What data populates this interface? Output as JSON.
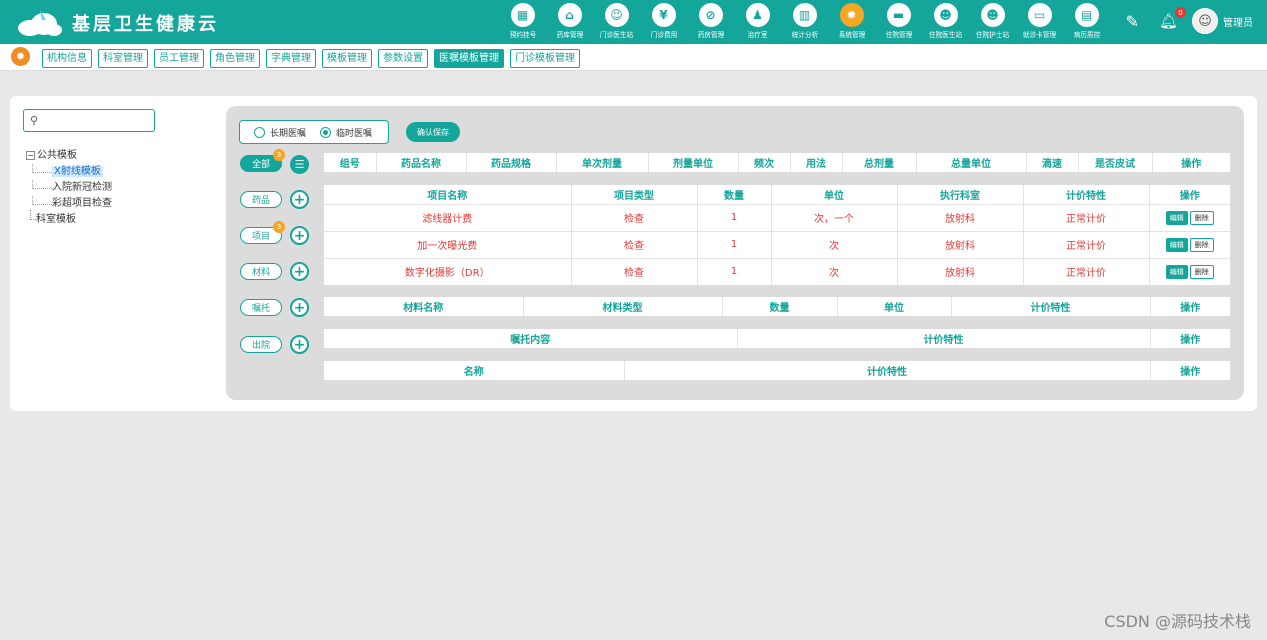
{
  "header": {
    "app_title": "基层卫生健康云",
    "nav": [
      {
        "label": "预约挂号",
        "icon": "calendar-icon",
        "glyph": "▦"
      },
      {
        "label": "药库管理",
        "icon": "warehouse-icon",
        "glyph": "⌂"
      },
      {
        "label": "门诊医生站",
        "icon": "doctor-icon",
        "glyph": "☺"
      },
      {
        "label": "门诊费用",
        "icon": "yen-icon",
        "glyph": "¥"
      },
      {
        "label": "药房管理",
        "icon": "pill-icon",
        "glyph": "⊘"
      },
      {
        "label": "治疗室",
        "icon": "therapy-icon",
        "glyph": "♟"
      },
      {
        "label": "统计分析",
        "icon": "chart-icon",
        "glyph": "▥"
      },
      {
        "label": "系统管理",
        "icon": "gear-icon",
        "glyph": "✹"
      },
      {
        "label": "住院管理",
        "icon": "bed-icon",
        "glyph": "▬"
      },
      {
        "label": "住院医生站",
        "icon": "inpatient-doctor-icon",
        "glyph": "☻"
      },
      {
        "label": "住院护士站",
        "icon": "nurse-icon",
        "glyph": "☻"
      },
      {
        "label": "就诊卡管理",
        "icon": "card-icon",
        "glyph": "▭"
      },
      {
        "label": "病历质控",
        "icon": "record-icon",
        "glyph": "▤"
      }
    ],
    "active_nav": 7,
    "notification_count": "0",
    "username": "管理员"
  },
  "tabs": [
    "机构信息",
    "科室管理",
    "员工管理",
    "角色管理",
    "字典管理",
    "模板管理",
    "参数设置",
    "医嘱模板管理",
    "门诊模板管理"
  ],
  "active_tab": 7,
  "search": {
    "placeholder": ""
  },
  "tree": {
    "root": "公共模板",
    "toggle": "−",
    "children": [
      "X射线模板",
      "入院新冠检测",
      "彩超项目检查"
    ],
    "selected": 0,
    "sibling": "科室模板"
  },
  "order_type": {
    "long_term": "长期医嘱",
    "temporary": "临时医嘱",
    "checked": "temporary"
  },
  "save_label": "确认保存",
  "categories": [
    {
      "label": "全部",
      "badge": "3"
    },
    {
      "label": "药品",
      "badge": ""
    },
    {
      "label": "项目",
      "badge": "3"
    },
    {
      "label": "材料",
      "badge": ""
    },
    {
      "label": "嘱托",
      "badge": ""
    },
    {
      "label": "出院",
      "badge": ""
    }
  ],
  "drug_table": {
    "headers": [
      "组号",
      "药品名称",
      "药品规格",
      "单次剂量",
      "剂量单位",
      "频次",
      "用法",
      "总剂量",
      "总量单位",
      "滴速",
      "是否皮试",
      "操作"
    ]
  },
  "item_table": {
    "headers": [
      "项目名称",
      "项目类型",
      "数量",
      "单位",
      "执行科室",
      "计价特性",
      "操作"
    ],
    "rows": [
      {
        "name": "滤线器计费",
        "type": "检查",
        "qty": "1",
        "unit": "次，一个",
        "dept": "放射科",
        "pricing": "正常计价"
      },
      {
        "name": "加一次曝光费",
        "type": "检查",
        "qty": "1",
        "unit": "次",
        "dept": "放射科",
        "pricing": "正常计价"
      },
      {
        "name": "数字化摄影（DR）",
        "type": "检查",
        "qty": "1",
        "unit": "次",
        "dept": "放射科",
        "pricing": "正常计价"
      }
    ],
    "edit_label": "编辑",
    "delete_label": "删除"
  },
  "material_table": {
    "headers": [
      "材料名称",
      "材料类型",
      "数量",
      "单位",
      "计价特性",
      "操作"
    ]
  },
  "entrust_table": {
    "headers": [
      "嘱托内容",
      "计价特性",
      "操作"
    ]
  },
  "discharge_table": {
    "headers": [
      "名称",
      "计价特性",
      "操作"
    ]
  },
  "watermark": "CSDN @源码技术栈"
}
